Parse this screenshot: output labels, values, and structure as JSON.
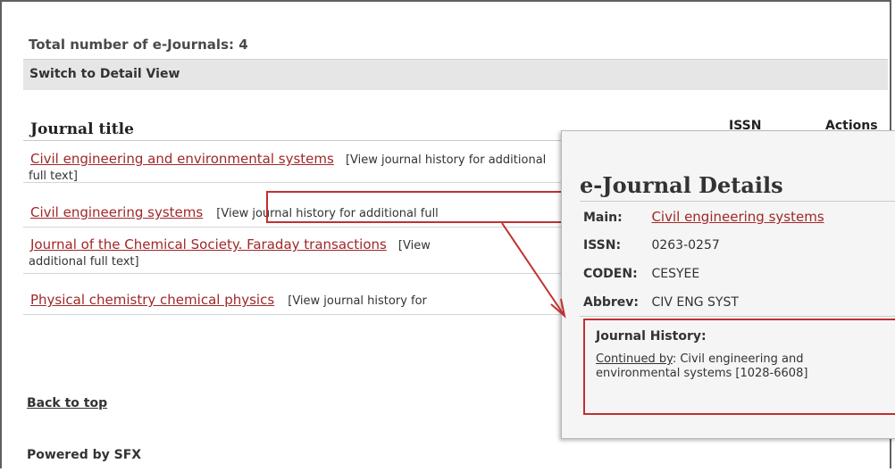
{
  "page": {
    "total_label": "Total number of e-Journals: 4",
    "switch_view": "Switch to Detail View",
    "back_to_top": "Back to top",
    "powered_by": "Powered by SFX"
  },
  "table": {
    "headers": {
      "title": "Journal title",
      "issn": "ISSN",
      "actions": "Actions"
    },
    "rows": [
      {
        "title": "Civil engineering and environmental systems",
        "history": "[View journal history for additional",
        "history_cont": "full text]"
      },
      {
        "title": "Civil engineering systems",
        "history": "[View journal history for additional full"
      },
      {
        "title": "Journal of the Chemical Society. Faraday transactions",
        "history": "[View",
        "history_cont": "additional full text]"
      },
      {
        "title": "Physical chemistry chemical physics",
        "history": "[View journal history for"
      }
    ]
  },
  "popup": {
    "title": "e-Journal Details",
    "main_label": "Main:",
    "main_value": "Civil engineering systems",
    "issn_label": "ISSN:",
    "issn_value": "0263-0257",
    "coden_label": "CODEN:",
    "coden_value": "CESYEE",
    "abbrev_label": "Abbrev:",
    "abbrev_value": "CIV ENG SYST",
    "history_title": "Journal History:",
    "history_link": "Continued by",
    "history_text": ": Civil engineering and environmental systems [1028-6608]"
  },
  "colors": {
    "link": "#a02828",
    "highlight": "#c03030"
  }
}
